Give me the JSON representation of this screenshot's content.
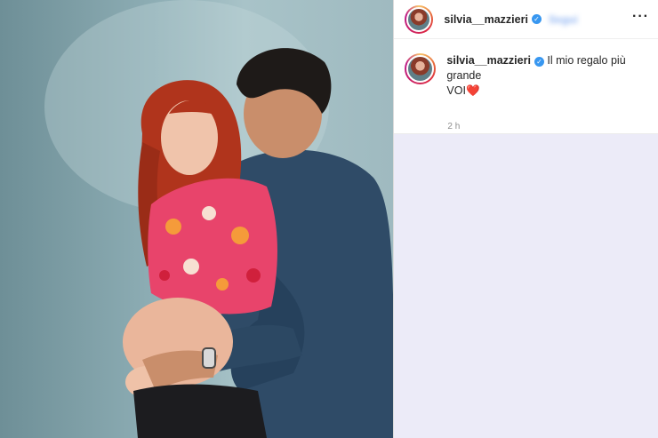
{
  "post": {
    "username": "silvia__mazzieri",
    "verified_badge": "✓",
    "follow_label": "Segui",
    "more_icon": "···",
    "caption": {
      "line1": "Il mio regalo più grande",
      "line2_text": "VOI",
      "line2_emoji": "❤️"
    },
    "timestamp": "2 h"
  },
  "colors": {
    "verified": "#3897f0",
    "panel_background": "#ecebf8",
    "heart": "#e0133f"
  },
  "icons": [
    "more-options-icon",
    "verified-badge-icon",
    "avatar"
  ]
}
